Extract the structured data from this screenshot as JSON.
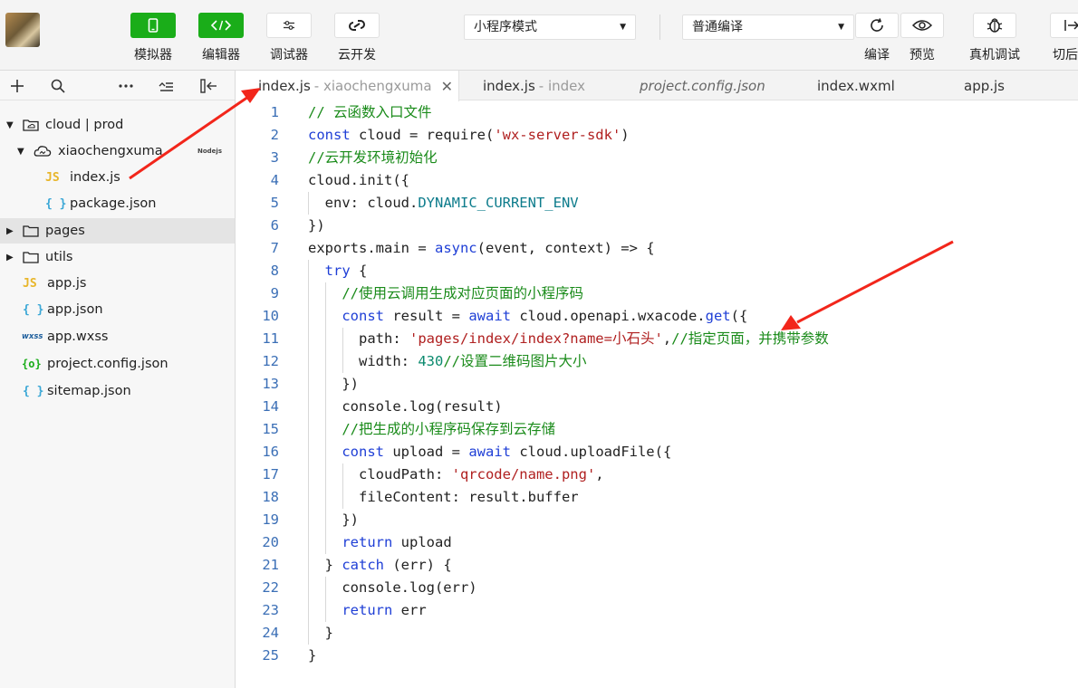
{
  "toolbar": {
    "buttons": [
      {
        "label": "模拟器"
      },
      {
        "label": "编辑器"
      },
      {
        "label": "调试器"
      },
      {
        "label": "云开发"
      }
    ],
    "mode_select": "小程序模式",
    "compile_select": "普通编译",
    "right_buttons": [
      {
        "label": "编译"
      },
      {
        "label": "预览"
      },
      {
        "label": "真机调试"
      },
      {
        "label": "切后台"
      }
    ]
  },
  "sidebar": {
    "tree": [
      {
        "label": "cloud | prod"
      },
      {
        "label": "xiaochengxuma",
        "badge": "Nodejs"
      },
      {
        "label": "index.js",
        "icon": "JS"
      },
      {
        "label": "package.json",
        "icon": "{ }"
      },
      {
        "label": "pages"
      },
      {
        "label": "utils"
      },
      {
        "label": "app.js",
        "icon": "JS"
      },
      {
        "label": "app.json",
        "icon": "{ }"
      },
      {
        "label": "app.wxss",
        "icon": "wxss"
      },
      {
        "label": "project.config.json",
        "icon": "{o}"
      },
      {
        "label": "sitemap.json",
        "icon": "{ }"
      }
    ]
  },
  "tabs": [
    {
      "name": "index.js",
      "sub": "- xiaochengxuma"
    },
    {
      "name": "index.js",
      "sub": "- index"
    },
    {
      "name": "project.config.json",
      "sub": ""
    },
    {
      "name": "index.wxml",
      "sub": ""
    },
    {
      "name": "app.js",
      "sub": ""
    }
  ],
  "code": [
    "// 云函数入口文件",
    "const cloud = require('wx-server-sdk')",
    "//云开发环境初始化",
    "cloud.init({",
    "  env: cloud.DYNAMIC_CURRENT_ENV",
    "})",
    "exports.main = async(event, context) => {",
    "  try {",
    "    //使用云调用生成对应页面的小程序码",
    "    const result = await cloud.openapi.wxacode.get({",
    "      path: 'pages/index/index?name=小石头',//指定页面，并携带参数",
    "      width: 430//设置二维码图片大小",
    "    })",
    "    console.log(result)",
    "    //把生成的小程序码保存到云存储",
    "    const upload = await cloud.uploadFile({",
    "      cloudPath: 'qrcode/name.png',",
    "      fileContent: result.buffer",
    "    })",
    "    return upload",
    "  } catch (err) {",
    "    console.log(err)",
    "    return err",
    "  }",
    "}"
  ],
  "colors": {
    "green": "#1aad19",
    "arrow": "#f2261b",
    "keyword": "#1f3fd6",
    "string": "#b02020",
    "comment": "#1a8b1a",
    "line_number": "#3b6fb6"
  }
}
